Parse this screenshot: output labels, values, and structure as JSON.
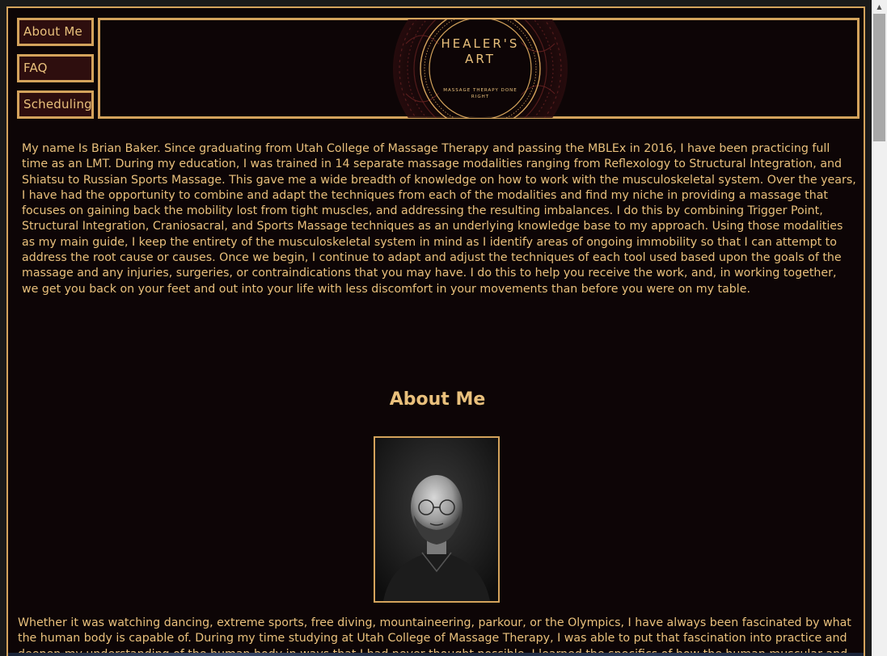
{
  "nav": {
    "items": [
      {
        "label": "About Me"
      },
      {
        "label": "FAQ"
      },
      {
        "label": "Scheduling"
      }
    ]
  },
  "logo": {
    "title_line1": "HEALER'S",
    "title_line2": "ART",
    "tagline_line1": "MASSAGE THERAPY DONE",
    "tagline_line2": "RIGHT"
  },
  "intro": {
    "text": "My name Is Brian Baker. Since graduating from Utah College of Massage Therapy and passing the MBLEx in 2016, I have been practicing full time as an LMT. During my education, I was trained in 14 separate massage modalities ranging from Reflexology to Structural Integration, and Shiatsu to Russian Sports Massage. This gave me a wide breadth of knowledge on how to work with the musculoskeletal system. Over the years, I have had the opportunity to combine and adapt the techniques from each of the modalities and find my niche in providing a massage that focuses on gaining back the mobility lost from tight muscles, and addressing the resulting imbalances. I do this by combining Trigger Point, Structural Integration, Craniosacral, and Sports Massage techniques as an underlying knowledge base to my approach. Using those modalities as my main guide, I keep the entirety of the musculoskeletal system in mind as I identify areas of ongoing immobility so that I can attempt to address the root cause or causes. Once we begin, I continue to adapt and adjust the techniques of each tool used based upon the goals of the massage and any injuries, surgeries, or contraindications that you may have. I do this to help you receive the work, and, in working together, we get you back on your feet and out into your life with less discomfort in your movements than before you were on my table."
  },
  "about": {
    "title": "About Me",
    "bio": "Whether it was watching dancing, extreme sports, free diving, mountaineering, parkour, or the Olympics, I have always been fascinated by what the human body is capable of. During my time studying at Utah College of Massage Therapy, I was able to put that fascination into practice and deepen my understanding of the human body in ways that I had never thought possible. I learned the specifics of how the human muscular and skeletal systems work together."
  },
  "colors": {
    "background": "#0d0506",
    "accent": "#d4a35c",
    "text": "#e9c07c",
    "button_bg": "#2e0e0e"
  }
}
